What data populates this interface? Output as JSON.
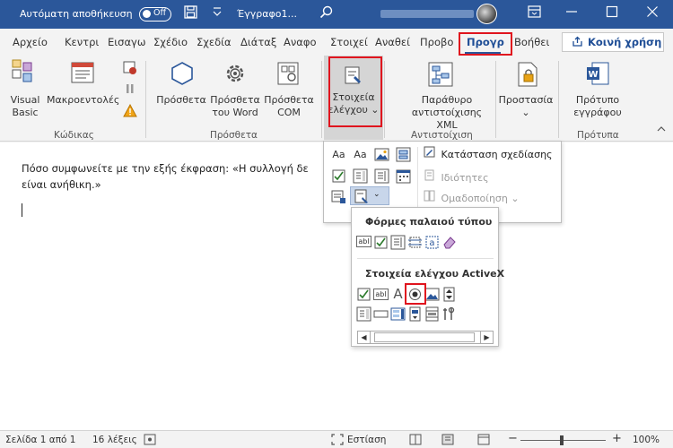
{
  "titlebar": {
    "autosave_label": "Αυτόματη αποθήκευση",
    "autosave_state": "Off",
    "doc_title": "Έγγραφο1...",
    "bg_color": "#2b579a"
  },
  "tabs": [
    {
      "label": "Αρχείο"
    },
    {
      "label": "Κεντρι"
    },
    {
      "label": "Εισαγω"
    },
    {
      "label": "Σχέδιο"
    },
    {
      "label": "Σχεδία"
    },
    {
      "label": "Διάταξ"
    },
    {
      "label": "Αναφο"
    },
    {
      "label": "Στοιχεί"
    },
    {
      "label": "Αναθεί"
    },
    {
      "label": "Προβο"
    },
    {
      "label": "Προγρ",
      "active": true
    },
    {
      "label": "Βοήθει"
    }
  ],
  "share_label": "Κοινή χρήση",
  "ribbon": {
    "groups": {
      "code": "Κώδικας",
      "addins": "Πρόσθετα",
      "mapping": "Αντιστοίχιση",
      "protect": "",
      "templates": "Πρότυπα"
    },
    "buttons": {
      "visual_basic": [
        "Visual",
        "Basic"
      ],
      "macros": "Μακροεντολές",
      "addins": "Πρόσθετα",
      "word_addins": [
        "Πρόσθετα",
        "του Word"
      ],
      "com_addins": [
        "Πρόσθετα",
        "COM"
      ],
      "controls": [
        "Στοιχεία",
        "ελέγχου ⌄"
      ],
      "xml_mapping": [
        "Παράθυρο",
        "αντιστοίχισης XML"
      ],
      "protection": [
        "Προστασία",
        "⌄"
      ],
      "doc_template": [
        "Πρότυπο",
        "εγγράφου"
      ]
    }
  },
  "document": {
    "text_line1": "Πόσο συμφωνείτε με την εξής έκφραση: «Η συλλογή δε",
    "text_line2": "είναι ανήθικη.»"
  },
  "controls_panel": {
    "design_mode": "Κατάσταση σχεδίασης",
    "properties": "Ιδιότητες",
    "group": "Ομαδοποίηση ⌄",
    "row1": [
      "Aa",
      "Aa"
    ]
  },
  "legacy_menu": {
    "legacy_header": "Φόρμες παλαιού τύπου",
    "legacy_text_icon": "abl",
    "activex_header": "Στοιχεία ελέγχου ActiveX",
    "activex_text_icon": "abl",
    "label_icon": "A"
  },
  "statusbar": {
    "page": "Σελίδα 1 από 1",
    "words": "16 λέξεις",
    "focus": "Εστίαση",
    "zoom": "100%"
  },
  "colors": {
    "accent": "#2b579a",
    "highlight": "#e0141e"
  }
}
